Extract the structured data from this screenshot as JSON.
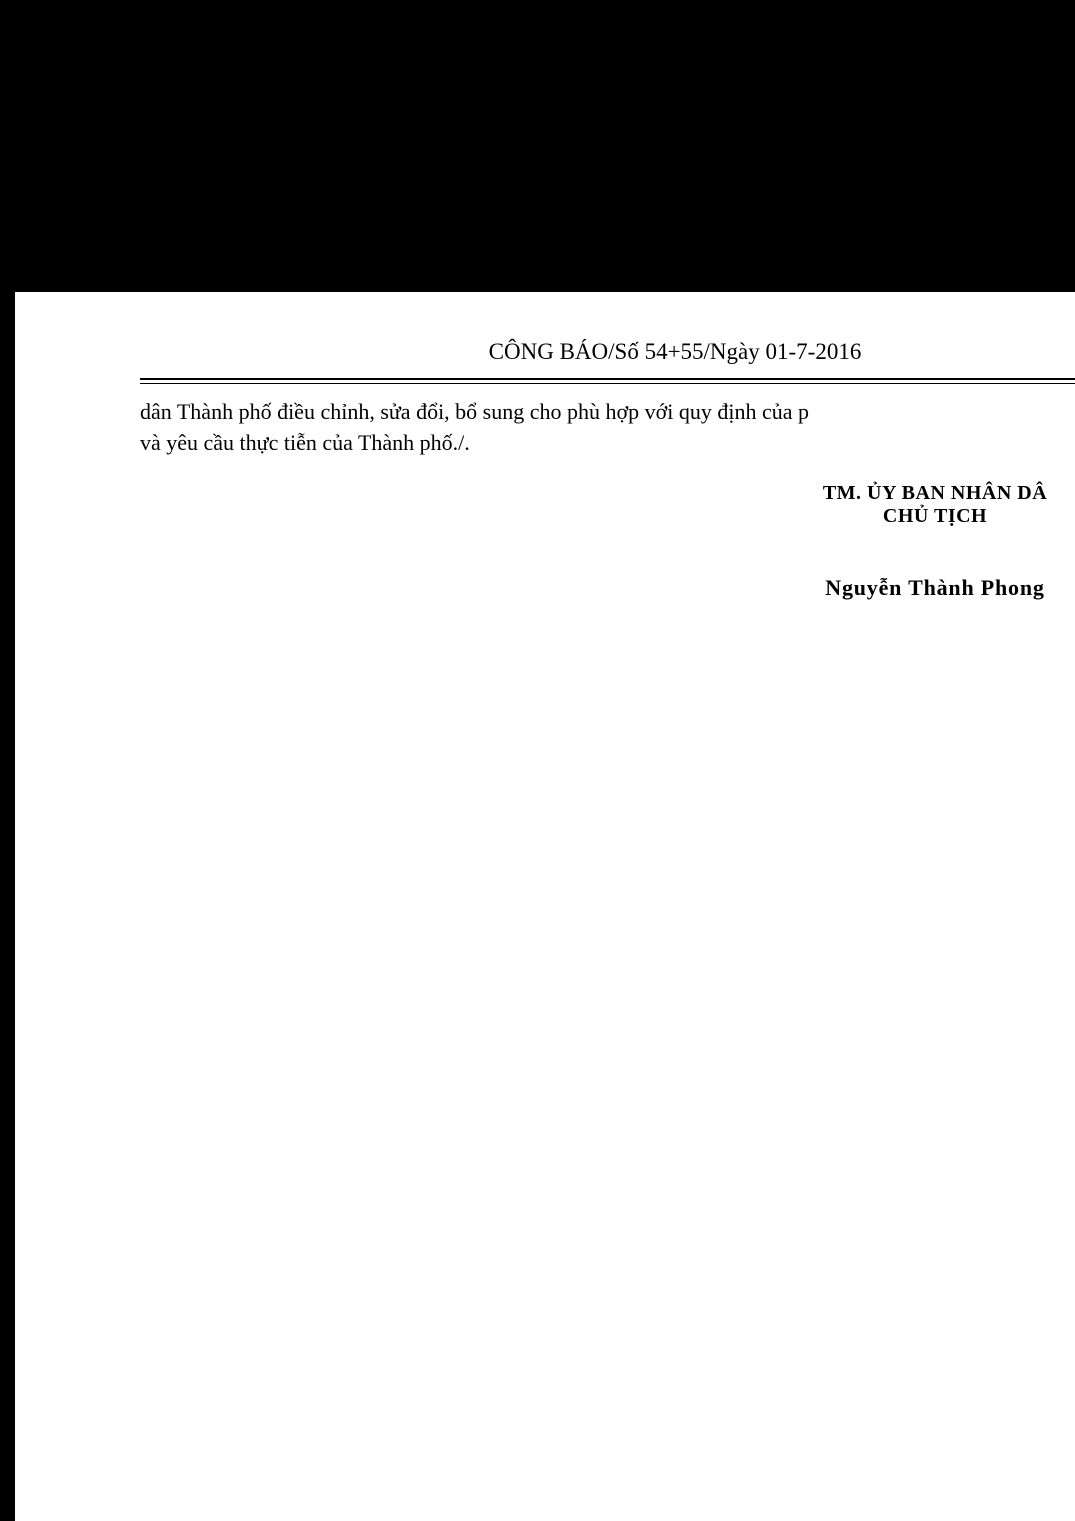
{
  "header": {
    "running_title": "CÔNG BÁO/Số 54+55/Ngày 01-7-2016"
  },
  "body": {
    "lines": [
      "dân Thành phố điều chỉnh, sửa đổi, bổ sung cho phù hợp với quy định của p",
      "và yêu cầu thực tiễn của Thành phố./."
    ]
  },
  "signature": {
    "organization": "TM. ỦY BAN NHÂN DÂ",
    "title": "CHỦ TỊCH",
    "name": "Nguyễn Thành Phong"
  }
}
